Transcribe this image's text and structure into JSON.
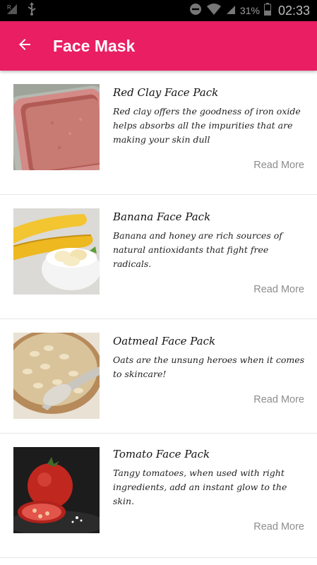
{
  "status_bar": {
    "battery_percent": "31%",
    "time": "02:33"
  },
  "app_bar": {
    "title": "Face Mask",
    "back_icon": "arrow-left-icon",
    "background_color": "#e91e63"
  },
  "items": [
    {
      "title": "Red Clay Face Pack",
      "description": "Red clay offers the goodness of iron oxide helps absorbs all the impurities that are making your skin dull",
      "action": "Read More",
      "image": "red-clay-powder-image"
    },
    {
      "title": "Banana Face Pack",
      "description": "Banana and honey are rich sources of natural antioxidants that fight free radicals.",
      "action": "Read More",
      "image": "banana-slices-image"
    },
    {
      "title": "Oatmeal Face Pack",
      "description": "Oats are the unsung heroes when it comes to skincare!",
      "action": "Read More",
      "image": "oatmeal-bowl-image"
    },
    {
      "title": "Tomato Face Pack",
      "description": "Tangy tomatoes, when used with right ingredients, add an instant glow to the skin.",
      "action": "Read More",
      "image": "tomato-image"
    }
  ]
}
